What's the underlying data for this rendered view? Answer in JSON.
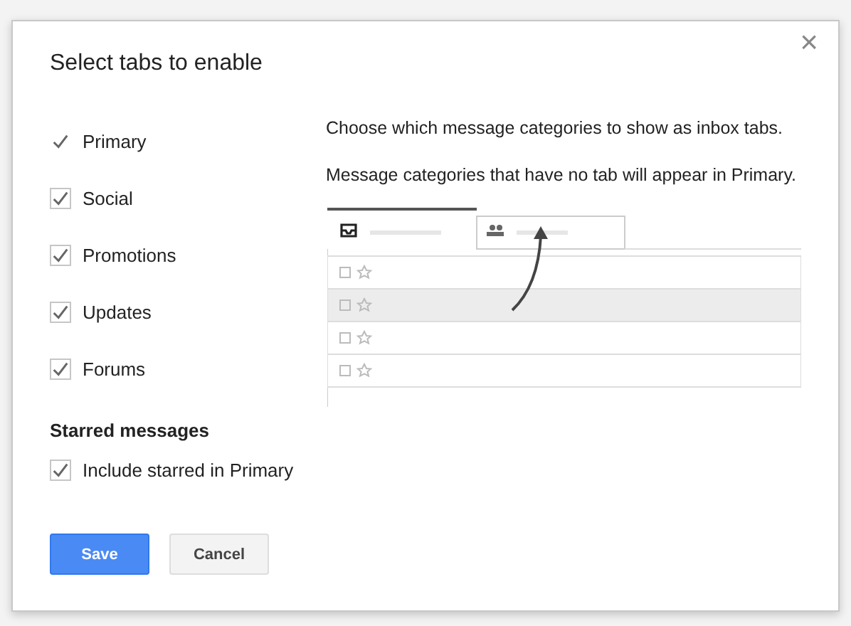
{
  "dialog": {
    "title": "Select tabs to enable",
    "close": "×"
  },
  "categories": [
    {
      "label": "Primary",
      "checked": true,
      "disabled": true
    },
    {
      "label": "Social",
      "checked": true,
      "disabled": false
    },
    {
      "label": "Promotions",
      "checked": true,
      "disabled": false
    },
    {
      "label": "Updates",
      "checked": true,
      "disabled": false
    },
    {
      "label": "Forums",
      "checked": true,
      "disabled": false
    }
  ],
  "starred": {
    "heading": "Starred messages",
    "option": {
      "label": "Include starred in Primary",
      "checked": true
    }
  },
  "description": [
    "Choose which message categories to show as inbox tabs.",
    "Message categories that have no tab will appear in Primary."
  ],
  "buttons": [
    {
      "label": "Save",
      "kind": "primary"
    },
    {
      "label": "Cancel",
      "kind": "secondary"
    }
  ]
}
